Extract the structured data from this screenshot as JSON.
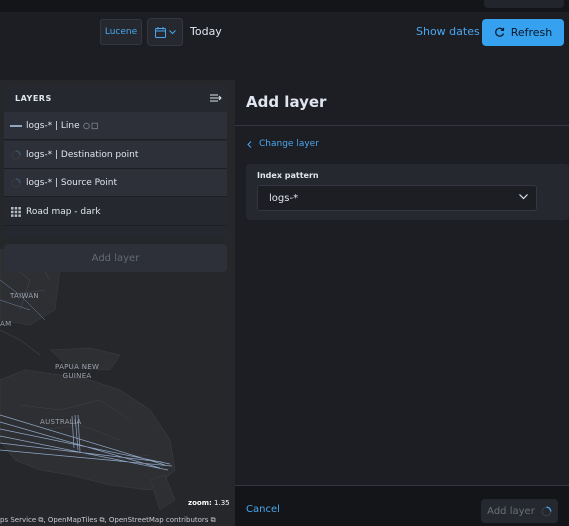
{
  "query_bar": {
    "language_label": "Lucene",
    "date_value": "Today",
    "show_dates_label": "Show dates",
    "refresh_label": "Refresh"
  },
  "layers_panel": {
    "title": "LAYERS",
    "layers": [
      {
        "name": "logs-* | Line",
        "icon": "line-icon"
      },
      {
        "name": "logs-* | Destination point",
        "icon": "loading-icon"
      },
      {
        "name": "logs-* | Source Point",
        "icon": "loading-icon"
      },
      {
        "name": "Road map - dark",
        "icon": "grid-icon"
      }
    ],
    "add_layer_label": "Add layer"
  },
  "map": {
    "labels": {
      "taiwan": "TAIWAN",
      "am": "AM",
      "papua": "PAPUA NEW\nGUINEA",
      "australia": "AUSTRALIA"
    },
    "zoom_label": "zoom:",
    "zoom_value": "1.35",
    "attribution": "ps Service ⧉, OpenMapTiles ⧉, OpenStreetMap contributors ⧉"
  },
  "flyout": {
    "title": "Add layer",
    "change_layer_label": "Change layer",
    "index_pattern_label": "Index pattern",
    "index_pattern_value": "logs-*",
    "cancel_label": "Cancel",
    "add_layer_label": "Add layer"
  },
  "colors": {
    "accent": "#36a2ef",
    "link": "#4aa7ef",
    "background": "#1d1e24",
    "panel": "#25282f"
  }
}
